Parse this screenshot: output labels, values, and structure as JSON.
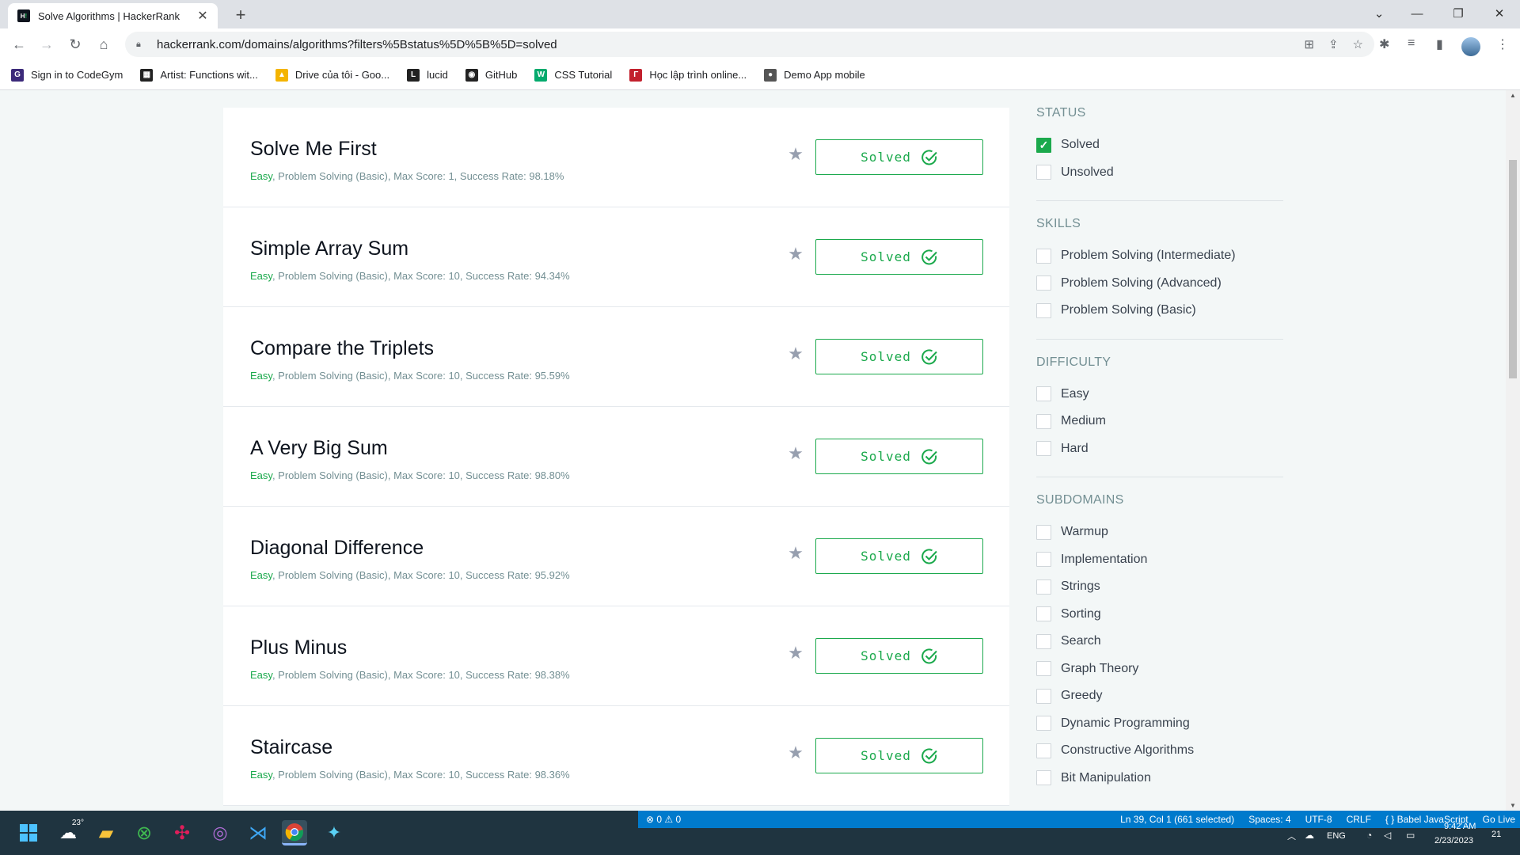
{
  "browser": {
    "tab_title": "Solve Algorithms | HackerRank",
    "url": "hackerrank.com/domains/algorithms?filters%5Bstatus%5D%5B%5D=solved"
  },
  "bookmarks": [
    {
      "label": "Sign in to CodeGym",
      "color": "#3c2a7a",
      "icon": "G"
    },
    {
      "label": "Artist: Functions wit...",
      "color": "#222222",
      "icon": "▦"
    },
    {
      "label": "Drive của tôi - Goo...",
      "color": "#f4b400",
      "icon": "▲"
    },
    {
      "label": "lucid",
      "color": "#222222",
      "icon": "L"
    },
    {
      "label": "GitHub",
      "color": "#222222",
      "icon": "◉"
    },
    {
      "label": "CSS Tutorial",
      "color": "#04aa6d",
      "icon": "W"
    },
    {
      "label": "Học lập trình online...",
      "color": "#c2202d",
      "icon": "Γ"
    },
    {
      "label": "Demo App mobile",
      "color": "#555555",
      "icon": "●"
    }
  ],
  "challenges": [
    {
      "name": "Solve Me First",
      "difficulty": "Easy",
      "meta": ", Problem Solving (Basic), Max Score: 1, Success Rate: 98.18%",
      "status": "Solved"
    },
    {
      "name": "Simple Array Sum",
      "difficulty": "Easy",
      "meta": ", Problem Solving (Basic), Max Score: 10, Success Rate: 94.34%",
      "status": "Solved"
    },
    {
      "name": "Compare the Triplets",
      "difficulty": "Easy",
      "meta": ", Problem Solving (Basic), Max Score: 10, Success Rate: 95.59%",
      "status": "Solved"
    },
    {
      "name": "A Very Big Sum",
      "difficulty": "Easy",
      "meta": ", Problem Solving (Basic), Max Score: 10, Success Rate: 98.80%",
      "status": "Solved"
    },
    {
      "name": "Diagonal Difference",
      "difficulty": "Easy",
      "meta": ", Problem Solving (Basic), Max Score: 10, Success Rate: 95.92%",
      "status": "Solved"
    },
    {
      "name": "Plus Minus",
      "difficulty": "Easy",
      "meta": ", Problem Solving (Basic), Max Score: 10, Success Rate: 98.38%",
      "status": "Solved"
    },
    {
      "name": "Staircase",
      "difficulty": "Easy",
      "meta": ", Problem Solving (Basic), Max Score: 10, Success Rate: 98.36%",
      "status": "Solved"
    }
  ],
  "filters": [
    {
      "heading": "STATUS",
      "items": [
        {
          "label": "Solved",
          "checked": true
        },
        {
          "label": "Unsolved",
          "checked": false
        }
      ]
    },
    {
      "heading": "SKILLS",
      "items": [
        {
          "label": "Problem Solving (Intermediate)",
          "checked": false
        },
        {
          "label": "Problem Solving (Advanced)",
          "checked": false
        },
        {
          "label": "Problem Solving (Basic)",
          "checked": false
        }
      ]
    },
    {
      "heading": "DIFFICULTY",
      "items": [
        {
          "label": "Easy",
          "checked": false
        },
        {
          "label": "Medium",
          "checked": false
        },
        {
          "label": "Hard",
          "checked": false
        }
      ]
    },
    {
      "heading": "SUBDOMAINS",
      "items": [
        {
          "label": "Warmup",
          "checked": false
        },
        {
          "label": "Implementation",
          "checked": false
        },
        {
          "label": "Strings",
          "checked": false
        },
        {
          "label": "Sorting",
          "checked": false
        },
        {
          "label": "Search",
          "checked": false
        },
        {
          "label": "Graph Theory",
          "checked": false
        },
        {
          "label": "Greedy",
          "checked": false
        },
        {
          "label": "Dynamic Programming",
          "checked": false
        },
        {
          "label": "Constructive Algorithms",
          "checked": false
        },
        {
          "label": "Bit Manipulation",
          "checked": false
        }
      ]
    }
  ],
  "vscode_status": {
    "problems": "⊗ 0 ⚠ 0",
    "cursor": "Ln 39, Col 1 (661 selected)",
    "spaces": "Spaces: 4",
    "encoding": "UTF-8",
    "eol": "CRLF",
    "language": "{ } Babel JavaScript",
    "golive": "Go Live"
  },
  "system_tray": {
    "weather": "23°",
    "lang": "ENG",
    "time": "9:42 AM",
    "date": "2/23/2023",
    "notif": "21"
  },
  "colors": {
    "accent_green": "#1ba94c",
    "vscode_blue": "#007acc",
    "taskbar": "#1f3440"
  }
}
